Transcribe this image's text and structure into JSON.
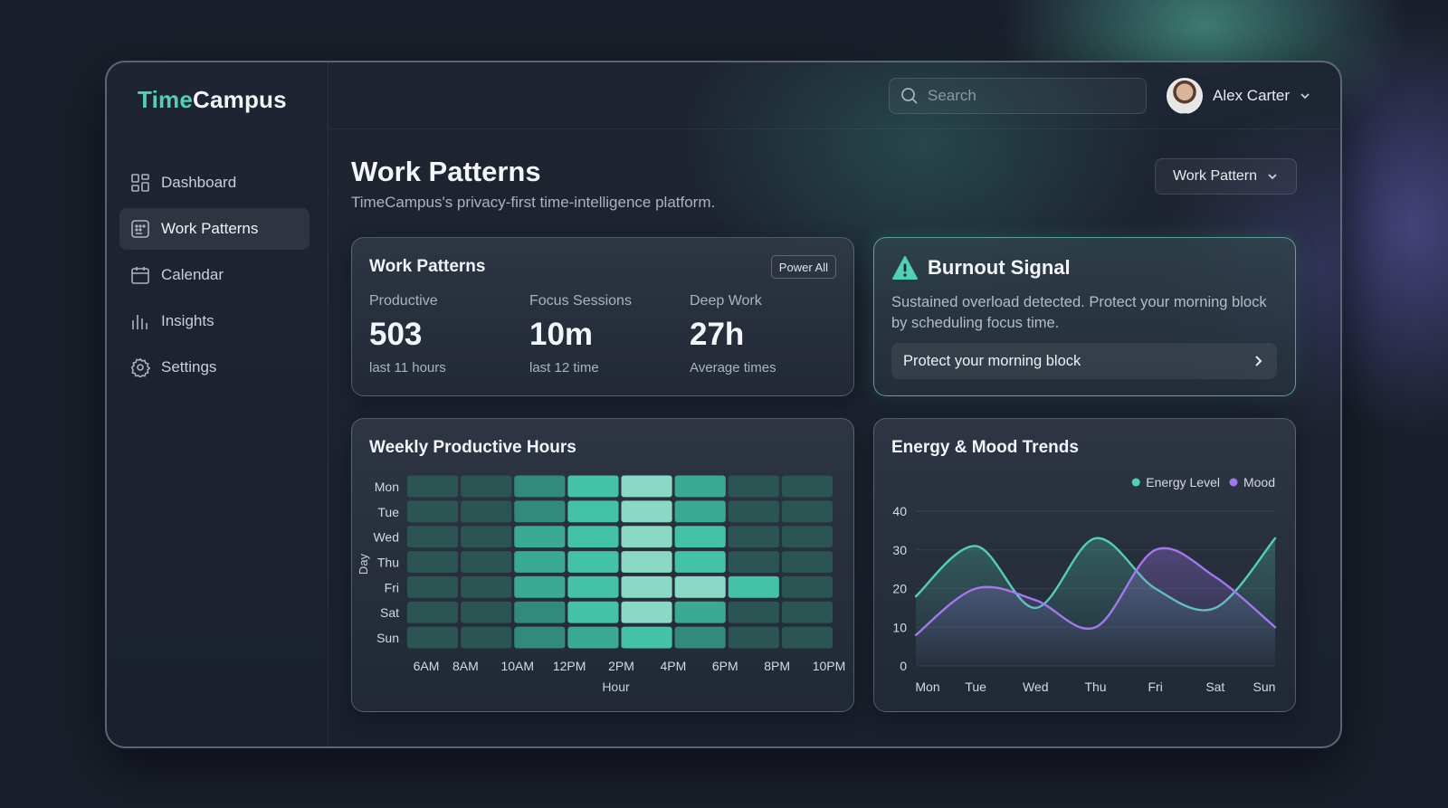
{
  "app": {
    "logo_part1": "Time",
    "logo_part2": "Campus"
  },
  "sidebar": {
    "items": [
      {
        "label": "Dashboard",
        "icon": "grid-icon",
        "active": false
      },
      {
        "label": "Work Patterns",
        "icon": "work-patterns-icon",
        "active": true
      },
      {
        "label": "Calendar",
        "icon": "calendar-icon",
        "active": false
      },
      {
        "label": "Insights",
        "icon": "bar-chart-icon",
        "active": false
      },
      {
        "label": "Settings",
        "icon": "gear-icon",
        "active": false
      }
    ]
  },
  "header": {
    "search_placeholder": "Search",
    "user_name": "Alex Carter"
  },
  "page": {
    "title": "Work Patterns",
    "subtitle": "TimeCampus's privacy-first time-intelligence platform.",
    "pattern_dropdown": "Work Pattern"
  },
  "stats_card": {
    "title": "Work Patterns",
    "action_label": "Power All",
    "stats": [
      {
        "label": "Productive",
        "value": "503",
        "sub": "last 11 hours"
      },
      {
        "label": "Focus Sessions",
        "value": "10m",
        "sub": "last 12 time"
      },
      {
        "label": "Deep Work",
        "value": "27h",
        "sub": "Average times"
      }
    ]
  },
  "burnout": {
    "title": "Burnout Signal",
    "text": "Sustained overload detected. Protect your morning block by scheduling focus time.",
    "action_label": "Protect your morning block",
    "accent": "#4fd1b3"
  },
  "colors": {
    "energy": "#4fd1b3",
    "mood": "#a277f0"
  },
  "chart_data": [
    {
      "type": "heatmap",
      "title": "Weekly Productive Hours",
      "xlabel": "Hour",
      "ylabel": "Day",
      "x": [
        "6AM",
        "8AM",
        "10AM",
        "12PM",
        "2PM",
        "4PM",
        "6PM",
        "8PM",
        "10PM"
      ],
      "y": [
        "Mon",
        "Tue",
        "Wed",
        "Thu",
        "Fri",
        "Sat",
        "Sun"
      ],
      "values": [
        [
          1,
          1,
          2,
          4,
          5,
          3,
          1,
          1
        ],
        [
          1,
          1,
          2,
          4,
          5,
          3,
          1,
          1
        ],
        [
          1,
          1,
          3,
          4,
          5,
          4,
          1,
          1
        ],
        [
          1,
          1,
          3,
          4,
          5,
          4,
          1,
          1
        ],
        [
          1,
          1,
          3,
          4,
          5,
          5,
          4,
          1
        ],
        [
          1,
          1,
          2,
          4,
          5,
          3,
          1,
          1
        ],
        [
          1,
          1,
          2,
          3,
          4,
          2,
          1,
          1
        ]
      ]
    },
    {
      "type": "line",
      "title": "Energy & Mood Trends",
      "categories": [
        "Mon",
        "Tue",
        "Wed",
        "Thu",
        "Fri",
        "Sat",
        "Sun"
      ],
      "ylim": [
        0,
        40
      ],
      "yticks": [
        0,
        10,
        20,
        30,
        40
      ],
      "legend": "top-right",
      "series": [
        {
          "name": "Energy Level",
          "values": [
            18,
            31,
            15,
            33,
            20,
            15,
            33
          ]
        },
        {
          "name": "Mood",
          "values": [
            8,
            20,
            17,
            10,
            30,
            23,
            10
          ]
        }
      ]
    }
  ]
}
